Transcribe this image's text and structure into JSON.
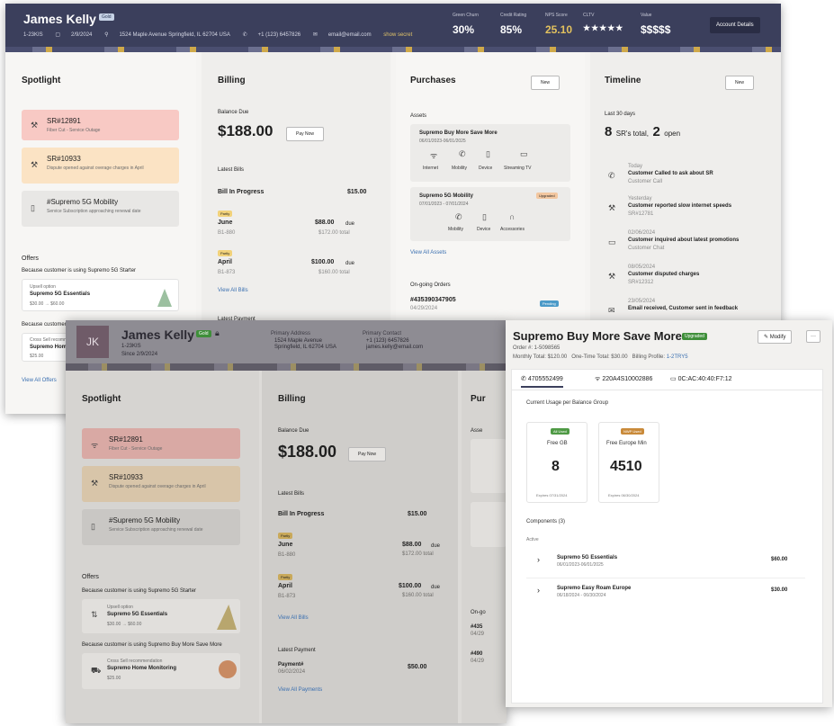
{
  "screen1": {
    "customer_name": "James Kelly",
    "badge": "Gold",
    "meta": [
      "1-23KIS",
      "2/9/2024",
      "1524 Maple Avenue Springfield, IL 62704 USA",
      "+1 (123) 6457826",
      "email@email.com",
      "show secret"
    ],
    "kpis": [
      {
        "label": "Green Churn",
        "value": "30%"
      },
      {
        "label": "Credit Rating",
        "value": "85%"
      },
      {
        "label": "NPS Score",
        "value": "25.10"
      },
      {
        "label": "CLTV",
        "value": "★★★★★"
      },
      {
        "label": "Value",
        "value": "$$$$$"
      }
    ],
    "account_details": "Account Details",
    "spotlight": {
      "title": "Spotlight",
      "items": [
        {
          "title": "SR#12891",
          "desc": "Fiber Cut - Service Outage"
        },
        {
          "title": "SR#10933",
          "desc": "Dispute opened against overage charges in April"
        },
        {
          "title": "#Supremo 5G Mobility",
          "desc": "Service Subscription approaching renewal date"
        }
      ],
      "offers_title": "Offers",
      "offer_note": "Because customer is using Supremo 5G Starter",
      "offer_label": "Upsell option",
      "offer_name": "Supremo 5G Essentials",
      "offer_price": "$30.00 → $60.00",
      "offer2_note": "Because customer is using Supremo Buy More Save More",
      "offer2_label": "Cross Sell recommendation",
      "offer2_name": "Supremo Home Monitoring",
      "offer2_price": "$25.00",
      "view_all": "View All Offers"
    },
    "billing": {
      "title": "Billing",
      "balance_label": "Balance Due",
      "balance": "$188.00",
      "pay_now": "Pay Now",
      "latest_bills": "Latest Bills",
      "in_progress_label": "Bill In Progress",
      "in_progress_amount": "$15.00",
      "bills": [
        {
          "tag": "Partly",
          "month": "June",
          "id": "B1-880",
          "amount": "$88.00",
          "suffix": "due",
          "total": "$172.00 total"
        },
        {
          "tag": "Partly",
          "month": "April",
          "id": "B1-873",
          "amount": "$100.00",
          "suffix": "due",
          "total": "$160.00 total"
        }
      ],
      "view_all": "View All Bills",
      "latest_payment": "Latest Payment"
    },
    "purchases": {
      "title": "Purchases",
      "new": "New",
      "assets_label": "Assets",
      "assets": [
        {
          "name": "Supremo Buy More Save More",
          "dates": "06/01/2023-06/01/2025",
          "services": [
            "Internet",
            "Mobility",
            "Device",
            "Streaming TV"
          ]
        },
        {
          "name": "Supremo 5G Mobility",
          "dates": "07/01/2023 - 07/01/2024",
          "tag": "Upgraded",
          "services": [
            "Mobility",
            "Device",
            "Accessories"
          ]
        }
      ],
      "view_all": "View All Assets",
      "orders_label": "On-going Orders",
      "order_id": "#435390347905",
      "order_date": "04/29/2024",
      "order_tag": "Pending"
    },
    "timeline": {
      "title": "Timeline",
      "new": "New",
      "range": "Last 30 days",
      "total": "8",
      "total_label": "SR's total,",
      "open": "2",
      "open_label": "open",
      "events": [
        {
          "when": "Today",
          "title": "Customer Called to ask about SR",
          "sub": "Customer Call"
        },
        {
          "when": "Yesterday",
          "title": "Customer reported slow internet speeds",
          "sub": "SR#12781"
        },
        {
          "when": "02/06/2024",
          "title": "Customer inquired about latest promotions",
          "sub": "Customer Chat"
        },
        {
          "when": "08/05/2024",
          "title": "Customer disputed charges",
          "sub": "SR#12312"
        },
        {
          "when": "23/05/2024",
          "title": "Email received, Customer sent in feedback",
          "sub": ""
        }
      ]
    }
  },
  "screen2": {
    "initials": "JK",
    "customer_name": "James Kelly",
    "badge": "Gold",
    "id": "1-23KIS",
    "since": "Since 2/9/2024",
    "address_label": "Primary Address",
    "address1": "1524 Maple Avenue",
    "address2": "Springfield, IL 62704 USA",
    "contact_label": "Primary Contact",
    "phone": "+1 (123) 6457826",
    "email": "james.kelly@email.com",
    "spotlight": {
      "title": "Spotlight",
      "items": [
        {
          "title": "SR#12891",
          "desc": "Fiber Cut - Service Outage"
        },
        {
          "title": "SR#10933",
          "desc": "Dispute opened against overage charges in April"
        },
        {
          "title": "#Supremo 5G Mobility",
          "desc": "Service Subscription approaching renewal date"
        }
      ],
      "offers_title": "Offers",
      "offer_note": "Because customer is using Supremo 5G Starter",
      "offer_label": "Upsell option",
      "offer_name": "Supremo 5G Essentials",
      "offer_price": "$30.00 → $60.00",
      "offer2_note": "Because customer is using Supremo Buy More Save More",
      "offer2_label": "Cross Sell recommendation",
      "offer2_name": "Supremo Home Monitoring",
      "offer2_price": "$25.00"
    },
    "billing": {
      "title": "Billing",
      "balance_label": "Balance Due",
      "balance": "$188.00",
      "pay_now": "Pay Now",
      "latest_bills": "Latest Bills",
      "in_progress_label": "Bill In Progress",
      "in_progress_amount": "$15.00",
      "bills": [
        {
          "tag": "Partly",
          "month": "June",
          "id": "B1-880",
          "amount": "$88.00",
          "suffix": "due",
          "total": "$172.00 total"
        },
        {
          "tag": "Partly",
          "month": "April",
          "id": "B1-873",
          "amount": "$100.00",
          "suffix": "due",
          "total": "$160.00 total"
        }
      ],
      "view_all": "View All Bills",
      "latest_payment": "Latest Payment",
      "payment_label": "Payment#",
      "payment_date": "06/02/2024",
      "payment_amount": "$50.00",
      "view_payments": "View All Payments"
    },
    "purchases_title": "Pur",
    "purchases_assets": "Asse",
    "orders_label": "On-go",
    "order1": "#435",
    "order1_date": "04/29",
    "order2": "#490",
    "order2_date": "04/29"
  },
  "screen3": {
    "title": "Supremo Buy More Save More",
    "badge": "Upgraded",
    "order": "Order #: 1-5098565",
    "monthly": "Monthly Total: $120.00",
    "one_time": "One-Time Total: $30.00",
    "billing_profile_label": "Billing Profile:",
    "billing_profile": "1-2TRY5",
    "modify": "Modify",
    "more": "···",
    "tabs": [
      {
        "label": "4705552499",
        "icon": "phone-icon"
      },
      {
        "label": "220A4S10002886",
        "icon": "wifi-icon"
      },
      {
        "label": "0C:AC:40:40:F7:12",
        "icon": "device-icon"
      }
    ],
    "usage_title": "Current Usage per Balance Group",
    "usage": [
      {
        "tag": "All Used",
        "name": "Free GB",
        "value": "8",
        "expires": "Expires 07/31/2024"
      },
      {
        "tag": "NWP Used",
        "name": "Free Europe Min",
        "value": "4510",
        "expires": "Expires 06/30/2024"
      }
    ],
    "components_title": "Components (3)",
    "active_label": "Active",
    "components": [
      {
        "name": "Supremo 5G Essentials",
        "dates": "06/01/2023-06/01/2025",
        "price": "$60.00"
      },
      {
        "name": "Supremo Easy Roam Europe",
        "dates": "06/18/2024 - 06/30/2024",
        "price": "$30.00"
      }
    ]
  },
  "colors": {
    "header_navy": "#3b3f5c",
    "spotlight_red": "#f8c9c4",
    "spotlight_orange": "#fbe3c4",
    "accent_green": "#3f8f3a",
    "link_blue": "#3a6fb0",
    "kpi_gold": "#e3c25e"
  }
}
